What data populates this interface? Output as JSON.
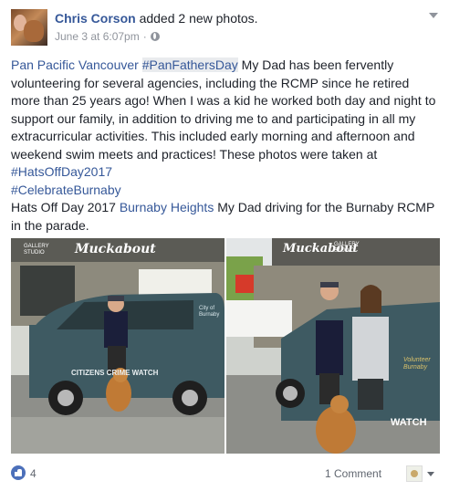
{
  "post": {
    "author": "Chris Corson",
    "action": "added 2 new photos.",
    "timestamp": "June 3 at 6:07pm",
    "separator": "·",
    "privacy_icon": "globe-icon",
    "options_icon": "chevron-down-icon",
    "text": {
      "l1": {
        "a": "Pan Pacific Vancouver",
        "b": "#PanFathersDay",
        "c": "My Dad has been fervently"
      },
      "l2": "volunteering for several agencies, including the RCMP since he retired",
      "l3": "more than 25 years ago! When I was a kid he worked both day and night to",
      "l4": "support our family, in addition to driving me to and participating in all my",
      "l5": "extracurricular activities. This included early morning and afternoon and",
      "l6": "weekend swim meets and practices! These photos were taken at",
      "l7": "#HatsOffDay2017",
      "l8": "#CelebrateBurnaby",
      "l9": {
        "a": "Hats Off Day 2017",
        "b": "Burnaby Heights",
        "c": "My Dad driving for the Burnaby RCMP"
      },
      "l10": "in the parade."
    },
    "photos": {
      "left": {
        "sign": "Muckabout",
        "gallery": "GALLERY STUDIO",
        "van_text": "CITIZENS CRIME WATCH",
        "door_text": "City of Burnaby"
      },
      "right": {
        "sign": "Muckabout",
        "gallery": "GALLERY STUDIO",
        "van_text": "WATCH",
        "logo_text": "Volunteer Burnaby"
      }
    }
  },
  "footer": {
    "like_icon": "thumbs-up-icon",
    "like_count": "4",
    "comment_count": "1 Comment",
    "page_avatar": "page-avatar",
    "dropdown_icon": "chevron-down-icon"
  },
  "colors": {
    "link": "#365899",
    "meta": "#90949c",
    "like": "#4c70ba",
    "van": "#3e5a62"
  }
}
